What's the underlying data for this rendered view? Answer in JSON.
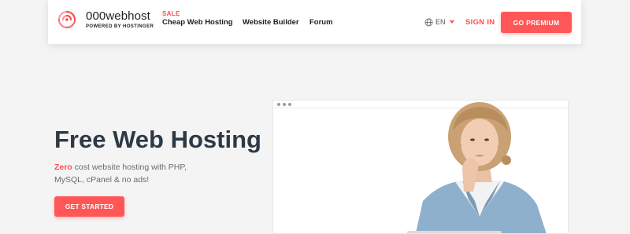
{
  "brand": {
    "name": "000webhost",
    "tagline": "POWERED BY HOSTINGER",
    "accent_color": "#ff5757",
    "dark_text_color": "#2d3a45"
  },
  "nav": {
    "sale_badge": "SALE",
    "links": [
      "Cheap Web Hosting",
      "Website Builder",
      "Forum"
    ],
    "language": {
      "icon": "globe-icon",
      "value": "EN"
    },
    "signin_label": "SIGN IN",
    "premium_label": "GO PREMIUM"
  },
  "hero": {
    "title": "Free Web Hosting",
    "desc_highlight": "Zero",
    "desc_rest": " cost website hosting with PHP, MySQL, cPanel & no ads!",
    "cta_label": "GET STARTED"
  },
  "preview": {
    "window_controls": "three-dots-icon",
    "image": "woman-in-denim-jacket-photo"
  }
}
